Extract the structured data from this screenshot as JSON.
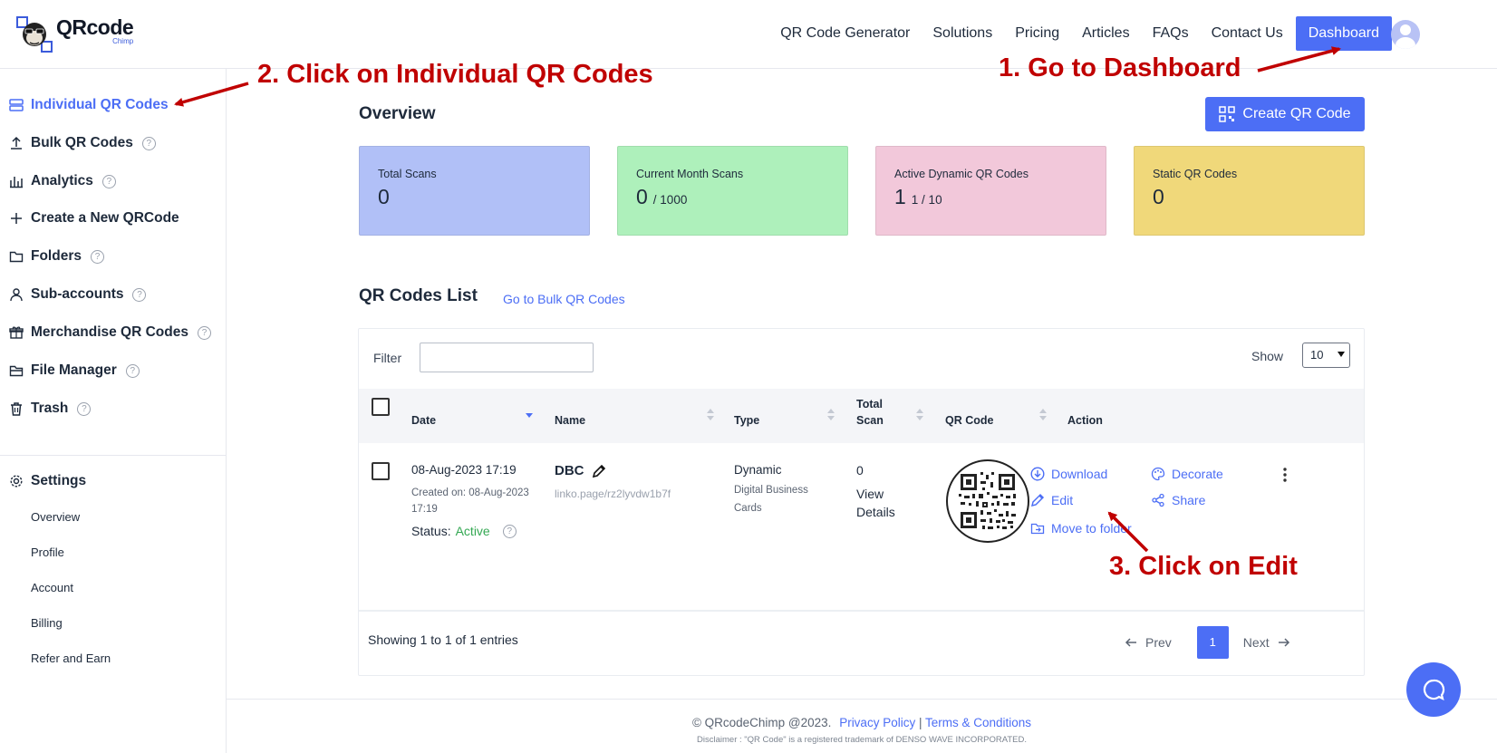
{
  "header": {
    "logo_main": "QRcode",
    "logo_sub": "Chimp",
    "nav": [
      "QR Code Generator",
      "Solutions",
      "Pricing",
      "Articles",
      "FAQs",
      "Contact Us"
    ],
    "dashboard_label": "Dashboard"
  },
  "sidebar": {
    "items": [
      {
        "label": "Individual QR Codes",
        "icon": "list-icon"
      },
      {
        "label": "Bulk QR Codes",
        "icon": "upload-icon"
      },
      {
        "label": "Analytics",
        "icon": "bar-chart-icon"
      },
      {
        "label": "Create a New QRCode",
        "icon": "plus-icon"
      },
      {
        "label": "Folders",
        "icon": "folder-icon"
      },
      {
        "label": "Sub-accounts",
        "icon": "user-icon"
      },
      {
        "label": "Merchandise QR Codes",
        "icon": "gift-icon"
      },
      {
        "label": "File Manager",
        "icon": "folder-open-icon"
      },
      {
        "label": "Trash",
        "icon": "trash-icon"
      }
    ],
    "help_glyph": "?",
    "settings_label": "Settings",
    "settings_items": [
      "Overview",
      "Profile",
      "Account",
      "Billing",
      "Refer and Earn"
    ]
  },
  "overview": {
    "title": "Overview",
    "create_label": "Create QR Code",
    "cards": [
      {
        "label": "Total Scans",
        "value": "0",
        "suffix": "",
        "color": "#b1c0f7"
      },
      {
        "label": "Current Month Scans",
        "value": "0",
        "suffix": "/ 1000",
        "color": "#aef0bb"
      },
      {
        "label": "Active Dynamic QR Codes",
        "value": "1",
        "suffix": "1 / 10",
        "color": "#f2c8da"
      },
      {
        "label": "Static QR Codes",
        "value": "0",
        "suffix": "",
        "color": "#f0d87a"
      }
    ]
  },
  "list": {
    "title": "QR Codes List",
    "bulk_link": "Go to Bulk QR Codes",
    "filter_label": "Filter",
    "filter_value": "",
    "show_label": "Show",
    "show_value": "10",
    "columns": {
      "date": "Date",
      "name": "Name",
      "type": "Type",
      "total_scan_1": "Total",
      "total_scan_2": "Scan",
      "qr_code": "QR Code",
      "action": "Action"
    },
    "row": {
      "date": "08-Aug-2023 17:19",
      "created": "Created on: 08-Aug-2023 17:19",
      "status_label": "Status:",
      "status_value": "Active",
      "name": "DBC",
      "url": "linko.page/rz2lyvdw1b7f",
      "type": "Dynamic",
      "subtype": "Digital Business Cards",
      "scans": "0",
      "view_details": "View Details",
      "actions": {
        "download": "Download",
        "decorate": "Decorate",
        "edit": "Edit",
        "share": "Share",
        "move": "Move to folder"
      }
    },
    "entries": "Showing 1 to 1 of 1 entries",
    "prev": "Prev",
    "page": "1",
    "next": "Next"
  },
  "footer": {
    "copyright": "© QRcodeChimp @2023.",
    "privacy": "Privacy Policy",
    "separator": "|",
    "terms": "Terms & Conditions",
    "disclaimer": "Disclaimer : \"QR Code\" is a registered trademark of DENSO WAVE INCORPORATED."
  },
  "annotations": {
    "step1": "1. Go to Dashboard",
    "step2": "2. Click on Individual QR Codes",
    "step3": "3. Click on Edit",
    "color": "#c00000"
  }
}
